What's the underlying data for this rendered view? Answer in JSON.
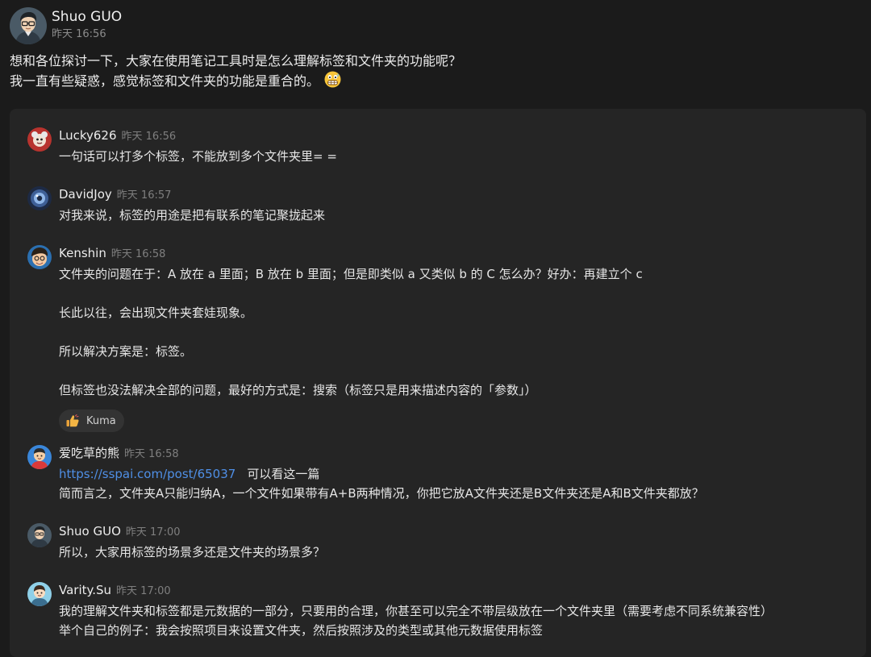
{
  "post": {
    "author": "Shuo GUO",
    "time": "昨天 16:56",
    "line1": "想和各位探讨一下，大家在使用笔记工具时是怎么理解标签和文件夹的功能呢？",
    "line2": "我一直有些疑惑，感觉标签和文件夹的功能是重合的。",
    "emoji": "grimacing-face-emoji"
  },
  "comments": [
    {
      "author": "Lucky626",
      "time": "昨天 16:56",
      "text": "一句话可以打多个标签，不能放到多个文件夹里= ="
    },
    {
      "author": "DavidJoy",
      "time": "昨天 16:57",
      "text": "对我来说，标签的用途是把有联系的笔记聚拢起来"
    },
    {
      "author": "Kenshin",
      "time": "昨天 16:58",
      "paragraphs": [
        "文件夹的问题在于：A 放在 a 里面；B 放在 b 里面；但是即类似 a 又类似 b 的 C 怎么办？好办：再建立个 c",
        "长此以往，会出现文件夹套娃现象。",
        "所以解决方案是：标签。",
        "但标签也没法解决全部的问题，最好的方式是：搜索（标签只是用来描述内容的「参数」）"
      ],
      "reaction": {
        "icon": "thumbs-up-icon",
        "name": "Kuma"
      }
    },
    {
      "author": "爱吃草的熊",
      "time": "昨天 16:58",
      "link": "https://sspai.com/post/65037",
      "link_suffix": "可以看这一篇",
      "text": "简而言之，文件夹A只能归纳A，一个文件如果带有A+B两种情况，你把它放A文件夹还是B文件夹还是A和B文件夹都放？"
    },
    {
      "author": "Shuo GUO",
      "time": "昨天 17:00",
      "text": "所以，大家用标签的场景多还是文件夹的场景多？"
    },
    {
      "author": "Varity.Su",
      "time": "昨天 17:00",
      "line1": "我的理解文件夹和标签都是元数据的一部分，只要用的合理，你甚至可以完全不带层级放在一个文件夹里（需要考虑不同系统兼容性）",
      "line2": "举个自己的例子：我会按照项目来设置文件夹，然后按照涉及的类型或其他元数据使用标签"
    }
  ],
  "colors": {
    "background": "#1b1b1b",
    "thread_panel": "#252525",
    "link": "#4f8fe6",
    "muted_text": "#7f7f7f",
    "reaction_chip": "#333333"
  }
}
